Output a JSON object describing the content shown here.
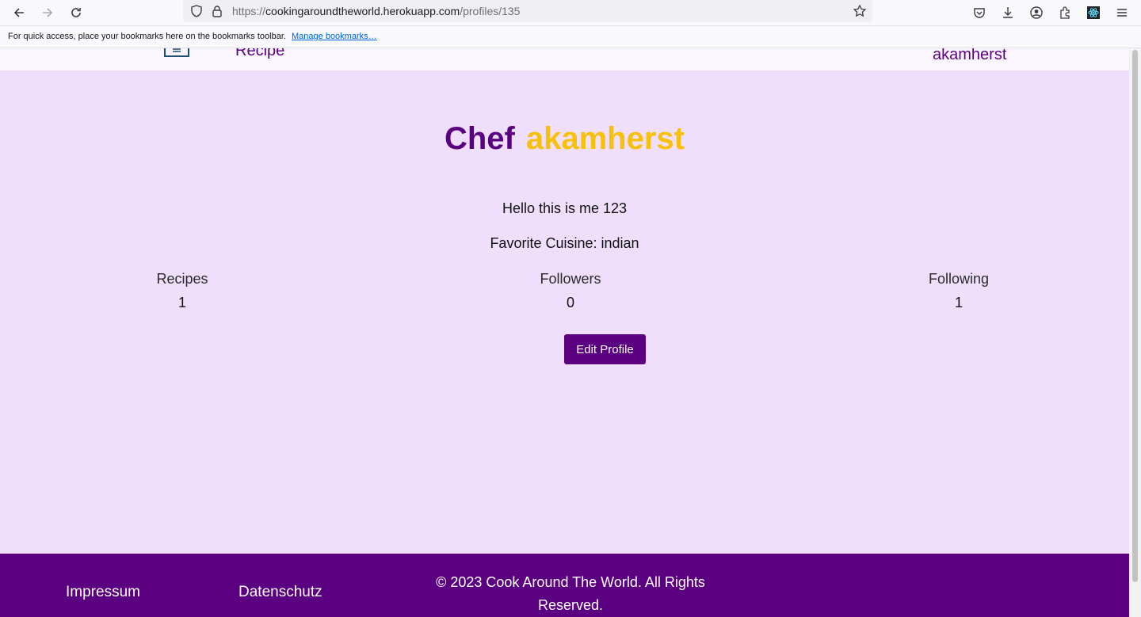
{
  "browser": {
    "url_prefix": "https://",
    "url_host": "cookingaroundtheworld.herokuapp.com",
    "url_path": "/profiles/135",
    "bookmarks_message": "For quick access, place your bookmarks here on the bookmarks toolbar.",
    "bookmarks_link": "Manage bookmarks…"
  },
  "nav": {
    "recipe_label": "Recipe",
    "user_label": "akamherst"
  },
  "profile": {
    "title_prefix": "Chef",
    "username": "akamherst",
    "bio": "Hello this is me 123",
    "favorite_cuisine_label": "Favorite Cuisine:",
    "favorite_cuisine": "indian",
    "stats": [
      {
        "label": "Recipes",
        "value": "1"
      },
      {
        "label": "Followers",
        "value": "0"
      },
      {
        "label": "Following",
        "value": "1"
      }
    ],
    "edit_button": "Edit Profile"
  },
  "footer": {
    "impressum": "Impressum",
    "datenschutz": "Datenschutz",
    "copyright": "© 2023 Cook Around The World. All Rights Reserved."
  },
  "colors": {
    "brand_purple": "#5a0080",
    "accent_yellow": "#f7c10a",
    "page_background": "#efdffd"
  }
}
